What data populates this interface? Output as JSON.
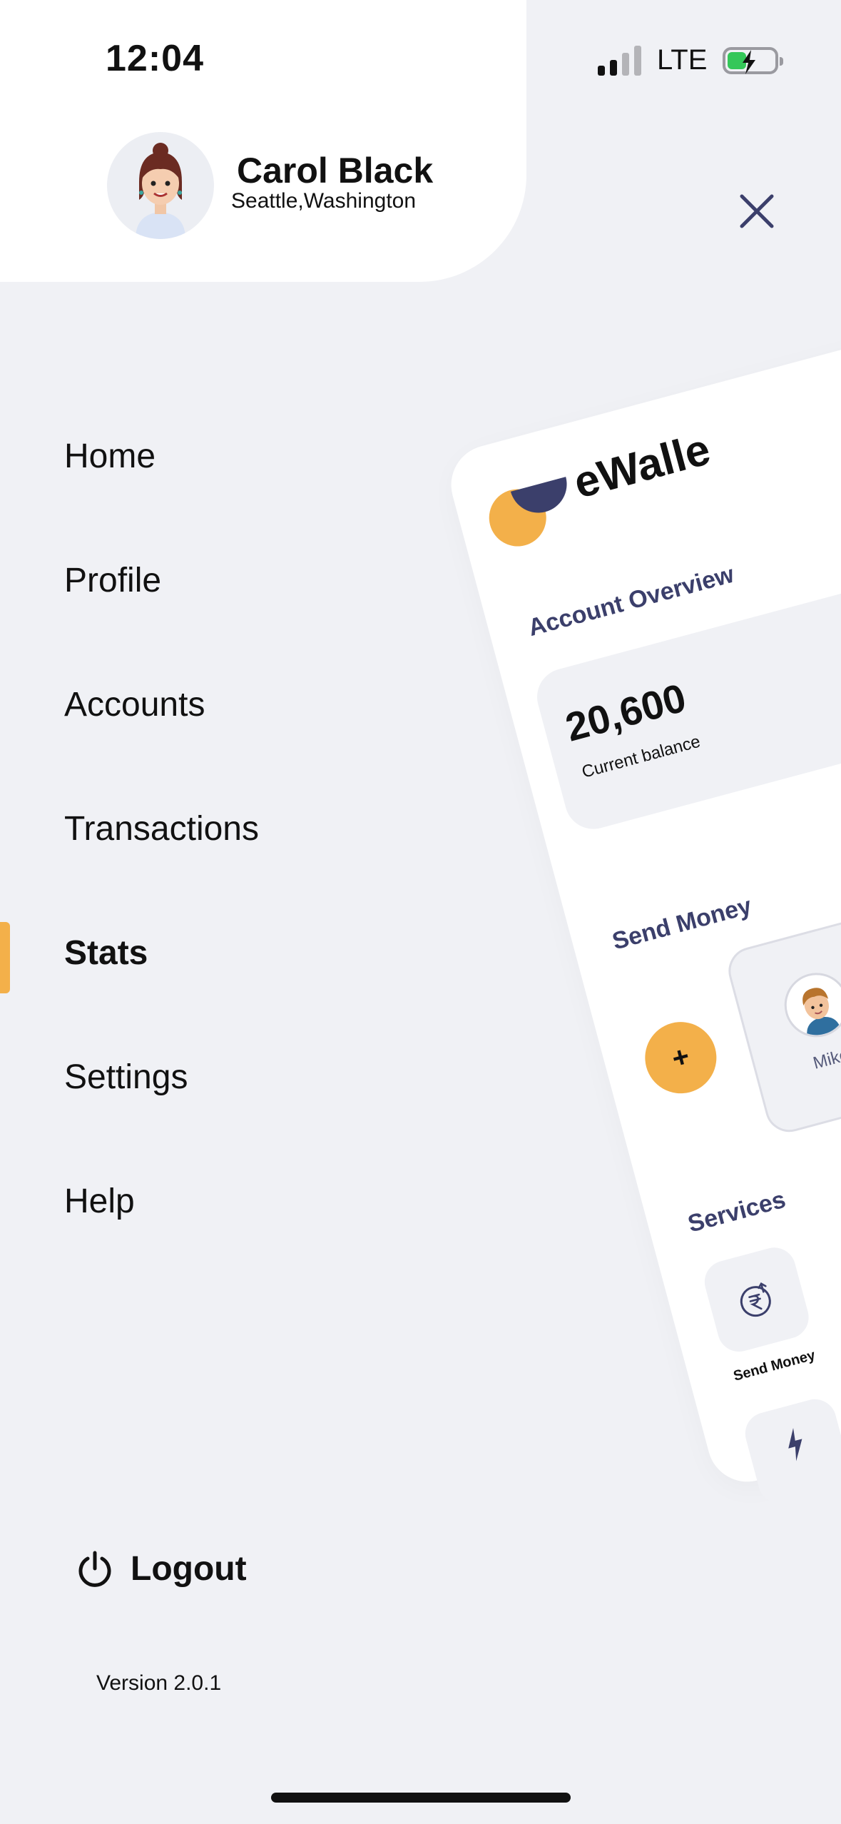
{
  "status": {
    "time": "12:04",
    "network": "LTE"
  },
  "user": {
    "name": "Carol Black",
    "location": "Seattle,Washington"
  },
  "menu": {
    "items": [
      {
        "label": "Home"
      },
      {
        "label": "Profile"
      },
      {
        "label": "Accounts"
      },
      {
        "label": "Transactions"
      },
      {
        "label": "Stats",
        "active": true
      },
      {
        "label": "Settings"
      },
      {
        "label": "Help"
      }
    ]
  },
  "logout": {
    "label": "Logout"
  },
  "version": "Version 2.0.1",
  "preview": {
    "logo": "eWalle",
    "account_overview": "Account Overview",
    "balance": "20,600",
    "balance_label": "Current balance",
    "send_money": "Send Money",
    "add_symbol": "+",
    "contact": "Mike",
    "services": "Services",
    "service_label": "Send Money"
  },
  "colors": {
    "accent": "#f3b04a",
    "navy": "#3b3f6b",
    "background": "#f0f1f5"
  }
}
